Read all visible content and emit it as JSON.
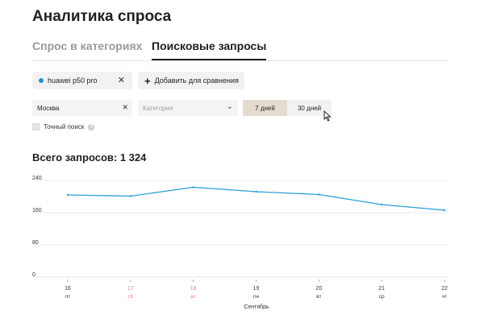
{
  "page": {
    "title": "Аналитика спроса"
  },
  "tabs": [
    {
      "label": "Спрос в категориях",
      "active": false
    },
    {
      "label": "Поисковые запросы",
      "active": true
    }
  ],
  "query_chip": {
    "label": "huawei p50 pro",
    "dot_color": "#1f8fe0"
  },
  "add_compare": {
    "label": "Добавить для сравнения"
  },
  "filters": {
    "city": {
      "value": "Москва"
    },
    "category": {
      "placeholder": "Категория"
    },
    "period": {
      "options": [
        "7 дней",
        "30 дней"
      ],
      "selected": "7 дней"
    },
    "exact_search": {
      "label": "Точный поиск",
      "checked": false
    }
  },
  "summary": {
    "total_text": "Всего запросов: 1 324"
  },
  "colors": {
    "line": "#2a9fd8",
    "weekend": "#e08a8a",
    "grid": "#e8e8e8"
  },
  "chart_data": {
    "type": "line",
    "title": "",
    "xlabel": "Сентябрь",
    "ylabel": "",
    "ylim": [
      0,
      240
    ],
    "yticks": [
      0,
      80,
      160,
      240
    ],
    "categories": [
      "16",
      "17",
      "18",
      "19",
      "20",
      "21",
      "22"
    ],
    "weekdays": [
      "пт",
      "сб",
      "вс",
      "пн",
      "вт",
      "ср",
      "чт"
    ],
    "weekend": [
      false,
      true,
      true,
      false,
      false,
      false,
      false
    ],
    "series": [
      {
        "values": [
          204,
          201,
          223,
          212,
          205,
          180,
          166
        ]
      }
    ],
    "grid": true
  }
}
